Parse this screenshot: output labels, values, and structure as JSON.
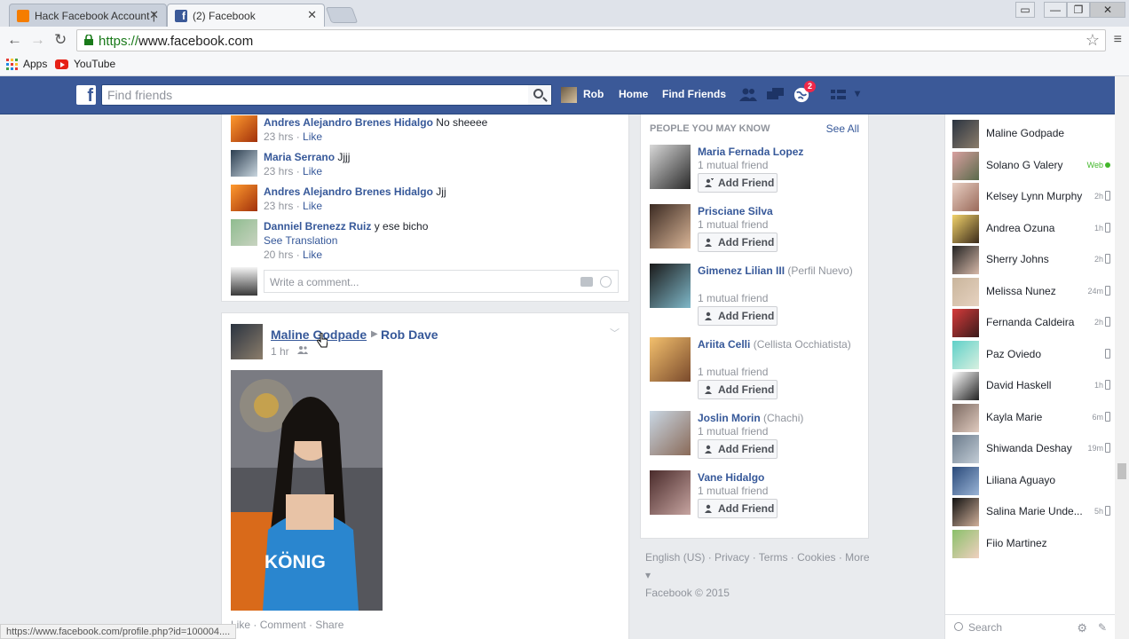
{
  "browser": {
    "tabs": [
      {
        "label": "Hack Facebook Account |",
        "favicon_color": "#f57d00"
      },
      {
        "label": "(2) Facebook",
        "favicon_color": "#3b5998"
      }
    ],
    "url_scheme": "https://",
    "url_host": "www.facebook.com",
    "bookmarks": {
      "apps": "Apps",
      "youtube": "YouTube"
    }
  },
  "fb": {
    "search_placeholder": "Find friends",
    "profile_name": "Rob",
    "home": "Home",
    "find_friends": "Find Friends",
    "notifications_count": "2"
  },
  "comments": [
    {
      "name": "Andres Alejandro Brenes Hidalgo",
      "text": "No sheeee",
      "time": "23 hrs",
      "like": "Like"
    },
    {
      "name": "Maria Serrano",
      "text": "Jjjj",
      "time": "23 hrs",
      "like": "Like"
    },
    {
      "name": "Andres Alejandro Brenes Hidalgo",
      "text": "Jjj",
      "time": "23 hrs",
      "like": "Like"
    },
    {
      "name": "Danniel Brenezz Ruiz",
      "text": "y ese bicho",
      "see_translation": "See Translation",
      "time": "20 hrs",
      "like": "Like"
    }
  ],
  "write_comment_placeholder": "Write a comment...",
  "post": {
    "author": "Maline Godpade",
    "target": "Rob Dave",
    "time": "1 hr",
    "image_text": "KÖNIG",
    "actions": [
      "Like",
      "Comment",
      "Share"
    ]
  },
  "pymk": {
    "heading": "PEOPLE YOU MAY KNOW",
    "see_all": "See All",
    "add_label": "Add Friend",
    "people": [
      {
        "name": "Maria Fernada Lopez",
        "extra": "",
        "mutual": "1 mutual friend"
      },
      {
        "name": "Prisciane Silva",
        "extra": "",
        "mutual": "1 mutual friend"
      },
      {
        "name": "Gimenez Lilian III",
        "extra": "(Perfil Nuevo)",
        "mutual": "1 mutual friend"
      },
      {
        "name": "Ariita Celli",
        "extra": "(Cellista Occhiatista)",
        "mutual": "1 mutual friend"
      },
      {
        "name": "Joslin Morin",
        "extra": "(Chachi)",
        "mutual": "1 mutual friend"
      },
      {
        "name": "Vane Hidalgo",
        "extra": "",
        "mutual": "1 mutual friend"
      }
    ]
  },
  "footer": {
    "line1": "English (US) · Privacy · Terms · Cookies · More ▾",
    "line2": "Facebook © 2015"
  },
  "chat": {
    "contacts": [
      {
        "name": "Maline Godpade",
        "status": "",
        "mobile": false,
        "web": false
      },
      {
        "name": "Solano G Valery",
        "status": "Web",
        "mobile": false,
        "web": true
      },
      {
        "name": "Kelsey Lynn Murphy",
        "status": "2h",
        "mobile": true,
        "web": false
      },
      {
        "name": "Andrea Ozuna",
        "status": "1h",
        "mobile": true,
        "web": false
      },
      {
        "name": "Sherry Johns",
        "status": "2h",
        "mobile": true,
        "web": false
      },
      {
        "name": "Melissa Nunez",
        "status": "24m",
        "mobile": true,
        "web": false
      },
      {
        "name": "Fernanda Caldeira",
        "status": "2h",
        "mobile": true,
        "web": false
      },
      {
        "name": "Paz Oviedo",
        "status": "",
        "mobile": true,
        "web": false
      },
      {
        "name": "David Haskell",
        "status": "1h",
        "mobile": true,
        "web": false
      },
      {
        "name": "Kayla Marie",
        "status": "6m",
        "mobile": true,
        "web": false
      },
      {
        "name": "Shiwanda Deshay",
        "status": "19m",
        "mobile": true,
        "web": false
      },
      {
        "name": "Liliana Aguayo",
        "status": "",
        "mobile": false,
        "web": false
      },
      {
        "name": "Salina Marie Unde...",
        "status": "5h",
        "mobile": true,
        "web": false
      },
      {
        "name": "Fiio Martinez",
        "status": "",
        "mobile": false,
        "web": false
      }
    ],
    "search_label": "Search"
  },
  "status_url": "https://www.facebook.com/profile.php?id=100004....",
  "colors": {
    "fb_blue": "#3b5998",
    "link": "#365899",
    "online": "#42b72a"
  }
}
